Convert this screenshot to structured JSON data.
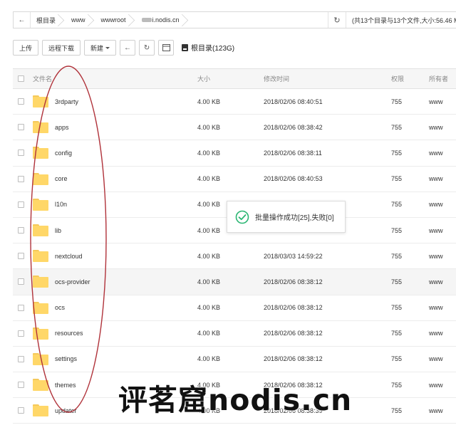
{
  "breadcrumb": {
    "items": [
      "根目录",
      "www",
      "wwwroot",
      "i.nodis.cn"
    ],
    "summary": "(共13个目录与13个文件,大小:56.46 MB"
  },
  "toolbar": {
    "upload": "上传",
    "remote_download": "远程下载",
    "new": "新建",
    "disk_label": "根目录(123G)"
  },
  "table": {
    "headers": {
      "name": "文件名",
      "size": "大小",
      "modified": "修改时间",
      "perm": "权限",
      "owner": "所有者"
    },
    "rows": [
      {
        "name": "3rdparty",
        "size": "4.00 KB",
        "time": "2018/02/06 08:40:51",
        "perm": "755",
        "owner": "www"
      },
      {
        "name": "apps",
        "size": "4.00 KB",
        "time": "2018/02/06 08:38:42",
        "perm": "755",
        "owner": "www"
      },
      {
        "name": "config",
        "size": "4.00 KB",
        "time": "2018/02/06 08:38:11",
        "perm": "755",
        "owner": "www"
      },
      {
        "name": "core",
        "size": "4.00 KB",
        "time": "2018/02/06 08:40:53",
        "perm": "755",
        "owner": "www"
      },
      {
        "name": "l10n",
        "size": "4.00 KB",
        "time": "",
        "perm": "755",
        "owner": "www"
      },
      {
        "name": "lib",
        "size": "4.00 KB",
        "time": "",
        "perm": "755",
        "owner": "www"
      },
      {
        "name": "nextcloud",
        "size": "4.00 KB",
        "time": "2018/03/03 14:59:22",
        "perm": "755",
        "owner": "www"
      },
      {
        "name": "ocs-provider",
        "size": "4.00 KB",
        "time": "2018/02/06 08:38:12",
        "perm": "755",
        "owner": "www"
      },
      {
        "name": "ocs",
        "size": "4.00 KB",
        "time": "2018/02/06 08:38:12",
        "perm": "755",
        "owner": "www"
      },
      {
        "name": "resources",
        "size": "4.00 KB",
        "time": "2018/02/06 08:38:12",
        "perm": "755",
        "owner": "www"
      },
      {
        "name": "settings",
        "size": "4.00 KB",
        "time": "2018/02/06 08:38:12",
        "perm": "755",
        "owner": "www"
      },
      {
        "name": "themes",
        "size": "4.00 KB",
        "time": "2018/02/06 08:38:12",
        "perm": "755",
        "owner": "www"
      },
      {
        "name": "updater",
        "size": "4.00 KB",
        "time": "2018/02/06 08:38:39",
        "perm": "755",
        "owner": "www"
      }
    ]
  },
  "toast": {
    "message": "批量操作成功[25],失败[0]"
  },
  "watermark": "评茗窟nodis.cn",
  "colors": {
    "folder": "#ffd768",
    "annotation": "#b0323a",
    "toast_check": "#2bb673"
  }
}
